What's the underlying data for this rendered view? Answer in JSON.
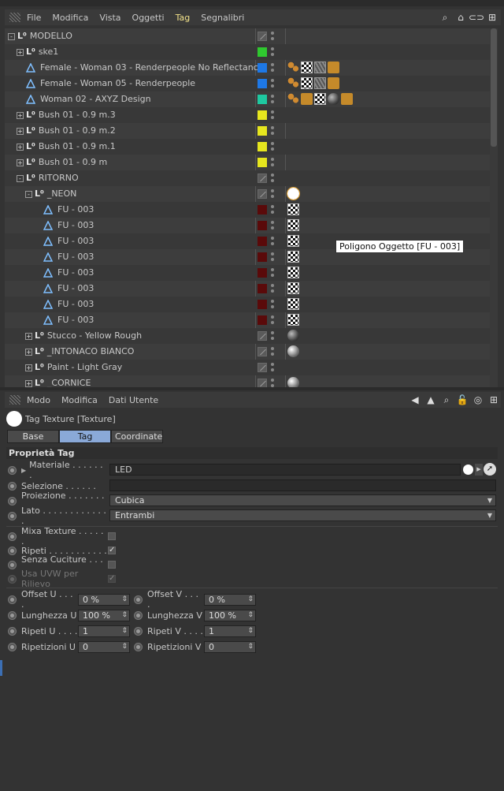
{
  "menu": {
    "items": [
      "File",
      "Modifica",
      "Vista",
      "Oggetti",
      "Tag",
      "Segnalibri"
    ],
    "active": "Tag"
  },
  "tree": {
    "rows": [
      {
        "name": "MODELLO",
        "indent": 0,
        "type": "null",
        "exp": "-",
        "vis": "slash",
        "tags": []
      },
      {
        "name": "ske1",
        "indent": 1,
        "type": "null",
        "exp": "+",
        "vis": "#2fc82f",
        "tags": []
      },
      {
        "name": "Female - Woman 03 - Renderpeople No Reflectance",
        "indent": 1,
        "type": "poly",
        "exp": "",
        "vis": "#1e78e6",
        "tags": [
          "dotsic",
          "checker",
          "noise",
          "orange"
        ]
      },
      {
        "name": "Female - Woman 05 - Renderpeople",
        "indent": 1,
        "type": "poly",
        "exp": "",
        "vis": "#1e78e6",
        "tags": [
          "dotsic",
          "checker",
          "noise",
          "orange"
        ]
      },
      {
        "name": "Woman 02 - AXYZ Design",
        "indent": 1,
        "type": "poly",
        "exp": "",
        "vis": "#1ec8a0",
        "tags": [
          "dotsic",
          "orange",
          "checker",
          "dark",
          "orange"
        ]
      },
      {
        "name": "Bush 01 - 0.9 m.3",
        "indent": 1,
        "type": "null",
        "exp": "+",
        "vis": "#e6e61e",
        "tags": []
      },
      {
        "name": "Bush 01 - 0.9 m.2",
        "indent": 1,
        "type": "null",
        "exp": "+",
        "vis": "#e6e61e",
        "tags": []
      },
      {
        "name": "Bush 01 - 0.9 m.1",
        "indent": 1,
        "type": "null",
        "exp": "+",
        "vis": "#e6e61e",
        "tags": []
      },
      {
        "name": "Bush 01 - 0.9 m",
        "indent": 1,
        "type": "null",
        "exp": "+",
        "vis": "#e6e61e",
        "tags": []
      },
      {
        "name": "RITORNO",
        "indent": 1,
        "type": "null",
        "exp": "-",
        "vis": "slash",
        "tags": []
      },
      {
        "name": "_NEON",
        "indent": 2,
        "type": "null",
        "exp": "-",
        "vis": "slash",
        "tags": [
          "white"
        ]
      },
      {
        "name": "FU - 003",
        "indent": 3,
        "type": "poly",
        "exp": "",
        "vis": "#5a0a0a",
        "tags": [
          "checker"
        ]
      },
      {
        "name": "FU - 003",
        "indent": 3,
        "type": "poly",
        "exp": "",
        "vis": "#5a0a0a",
        "tags": [
          "checker"
        ]
      },
      {
        "name": "FU - 003",
        "indent": 3,
        "type": "poly",
        "exp": "",
        "vis": "#5a0a0a",
        "tags": [
          "checker"
        ]
      },
      {
        "name": "FU - 003",
        "indent": 3,
        "type": "poly",
        "exp": "",
        "vis": "#5a0a0a",
        "tags": [
          "checker"
        ]
      },
      {
        "name": "FU - 003",
        "indent": 3,
        "type": "poly",
        "exp": "",
        "vis": "#5a0a0a",
        "tags": [
          "checker"
        ]
      },
      {
        "name": "FU - 003",
        "indent": 3,
        "type": "poly",
        "exp": "",
        "vis": "#5a0a0a",
        "tags": [
          "checker"
        ]
      },
      {
        "name": "FU - 003",
        "indent": 3,
        "type": "poly",
        "exp": "",
        "vis": "#5a0a0a",
        "tags": [
          "checker"
        ]
      },
      {
        "name": "FU - 003",
        "indent": 3,
        "type": "poly",
        "exp": "",
        "vis": "#5a0a0a",
        "tags": [
          "checker"
        ]
      },
      {
        "name": "Stucco - Yellow Rough",
        "indent": 2,
        "type": "null",
        "exp": "+",
        "vis": "slash",
        "tags": [
          "dark"
        ]
      },
      {
        "name": "_INTONACO BIANCO",
        "indent": 2,
        "type": "null",
        "exp": "+",
        "vis": "slash",
        "tags": [
          "sphere"
        ]
      },
      {
        "name": "Paint - Light Gray",
        "indent": 2,
        "type": "null",
        "exp": "+",
        "vis": "slash",
        "tags": []
      },
      {
        "name": "_CORNICE",
        "indent": 2,
        "type": "null",
        "exp": "+",
        "vis": "slash",
        "tags": [
          "sphere"
        ]
      }
    ],
    "tooltip": "Poligono Oggetto [FU - 003]"
  },
  "attr_menu": {
    "items": [
      "Modo",
      "Modifica",
      "Dati Utente"
    ]
  },
  "attr": {
    "title": "Tag Texture [Texture]",
    "tabs": [
      "Base",
      "Tag",
      "Coordinate"
    ],
    "selected_tab": "Tag",
    "section": "Proprietà Tag",
    "materiale_label": "Materiale . . . . . . .",
    "materiale_value": "LED",
    "selezione_label": "Selezione . . . . . .",
    "proiezione_label": "Proiezione . . . . . . . .",
    "proiezione_value": "Cubica",
    "lato_label": "Lato . . . . . . . . . . . . .",
    "lato_value": "Entrambi",
    "mixa_label": "Mixa Texture . . . . . .",
    "ripeti_label": "Ripeti . . . . . . . . . . .",
    "senza_label": "Senza Cuciture . . . .",
    "usa_label": "Usa UVW per Rilievo",
    "checkmark": "✓",
    "offset_u_label": "Offset U . . . .",
    "offset_u": "0 %",
    "offset_v_label": "Offset V . . . .",
    "offset_v": "0 %",
    "lung_u_label": "Lunghezza U",
    "lung_u": "100 %",
    "lung_v_label": "Lunghezza V",
    "lung_v": "100 %",
    "rip_u_label": "Ripeti U . . . .",
    "rip_u": "1",
    "rip_v_label": "Ripeti V . . . .",
    "rip_v": "1",
    "ripz_u_label": "Ripetizioni U",
    "ripz_u": "0",
    "ripz_v_label": "Ripetizioni V",
    "ripz_v": "0"
  }
}
